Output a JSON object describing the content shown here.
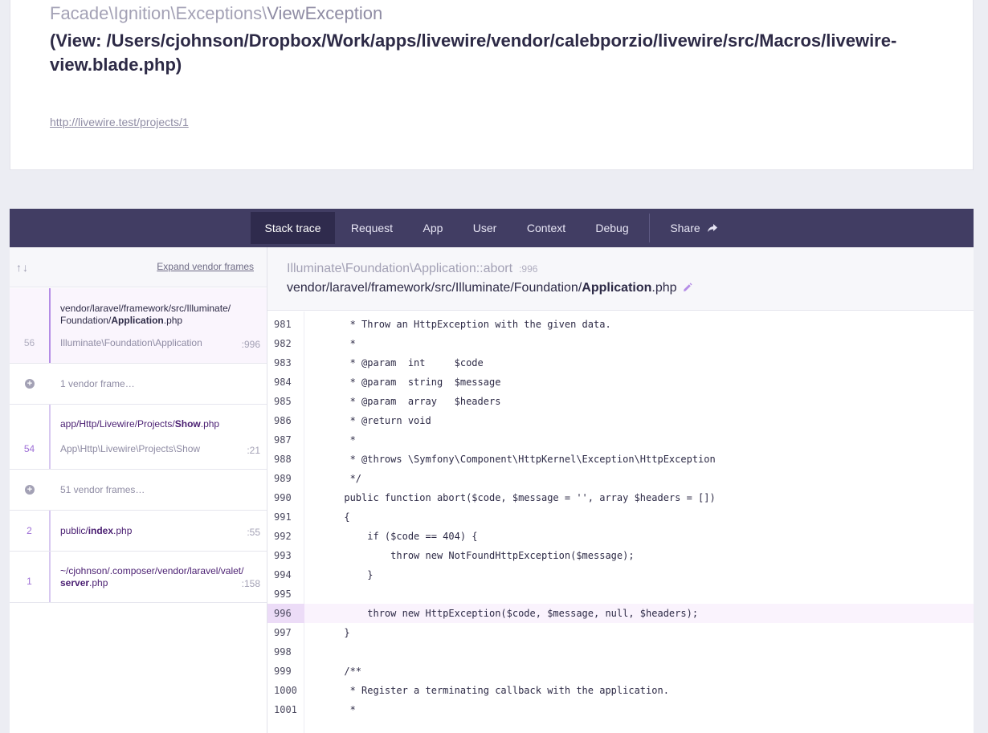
{
  "header": {
    "exception_ns": "Facade\\Ignition\\Exceptions\\",
    "exception_name": "ViewException",
    "message": "(View: /Users/cjohnson/Dropbox/Work/apps/livewire/vendor/calebporzio/livewire/src/Macros/livewire-view.blade.php)",
    "url": "http://livewire.test/projects/1"
  },
  "tabs": [
    {
      "label": "Stack trace",
      "active": true
    },
    {
      "label": "Request"
    },
    {
      "label": "App"
    },
    {
      "label": "User"
    },
    {
      "label": "Context"
    },
    {
      "label": "Debug"
    },
    {
      "label": "Share"
    }
  ],
  "sidebar": {
    "arrows": "↑↓",
    "expand_label": "Expand vendor frames",
    "frames": [
      {
        "num": "56",
        "path_pre": "vendor/laravel/framework/src/Illuminate/ Foundation/",
        "path_bold": "Application",
        "path_ext": ".php",
        "cls_pre": "Illuminate\\Foundation\\",
        "cls_name": "Application",
        "line": ":996"
      },
      {
        "vendor": "1 vendor frame…"
      },
      {
        "num": "54",
        "path_pre": "app/Http/Livewire/Projects/",
        "path_bold": "Show",
        "path_ext": ".php",
        "cls_pre": "App\\Http\\Livewire\\Projects\\",
        "cls_name": "Show",
        "line": ":21"
      },
      {
        "vendor": "51 vendor frames…"
      },
      {
        "num": "2",
        "path_pre": "public/",
        "path_bold": "index",
        "path_ext": ".php",
        "line": ":55"
      },
      {
        "num": "1",
        "path_pre": "~/cjohnson/.composer/vendor/laravel/valet/ ",
        "path_bold": "server",
        "path_ext": ".php",
        "line": ":158"
      }
    ]
  },
  "main": {
    "class_pre": "Illuminate\\Foundation\\",
    "class_name": "Application",
    "method": "::abort",
    "line": ":996",
    "file_pre": "vendor/laravel/framework/src/Illuminate/Foundation/",
    "file_bold": "Application",
    "file_ext": ".php",
    "code": [
      {
        "n": "981",
        "t": "       * Throw an HttpException with the given data."
      },
      {
        "n": "982",
        "t": "       *"
      },
      {
        "n": "983",
        "t": "       * @param  int     $code"
      },
      {
        "n": "984",
        "t": "       * @param  string  $message"
      },
      {
        "n": "985",
        "t": "       * @param  array   $headers"
      },
      {
        "n": "986",
        "t": "       * @return void"
      },
      {
        "n": "987",
        "t": "       *"
      },
      {
        "n": "988",
        "t": "       * @throws \\Symfony\\Component\\HttpKernel\\Exception\\HttpException"
      },
      {
        "n": "989",
        "t": "       */"
      },
      {
        "n": "990",
        "t": "      public function abort($code, $message = '', array $headers = [])"
      },
      {
        "n": "991",
        "t": "      {"
      },
      {
        "n": "992",
        "t": "          if ($code == 404) {"
      },
      {
        "n": "993",
        "t": "              throw new NotFoundHttpException($message);"
      },
      {
        "n": "994",
        "t": "          }"
      },
      {
        "n": "995",
        "t": ""
      },
      {
        "n": "996",
        "t": "          throw new HttpException($code, $message, null, $headers);",
        "hl": true
      },
      {
        "n": "997",
        "t": "      }"
      },
      {
        "n": "998",
        "t": ""
      },
      {
        "n": "999",
        "t": "      /**"
      },
      {
        "n": "1000",
        "t": "       * Register a terminating callback with the application."
      },
      {
        "n": "1001",
        "t": "       *"
      }
    ]
  }
}
